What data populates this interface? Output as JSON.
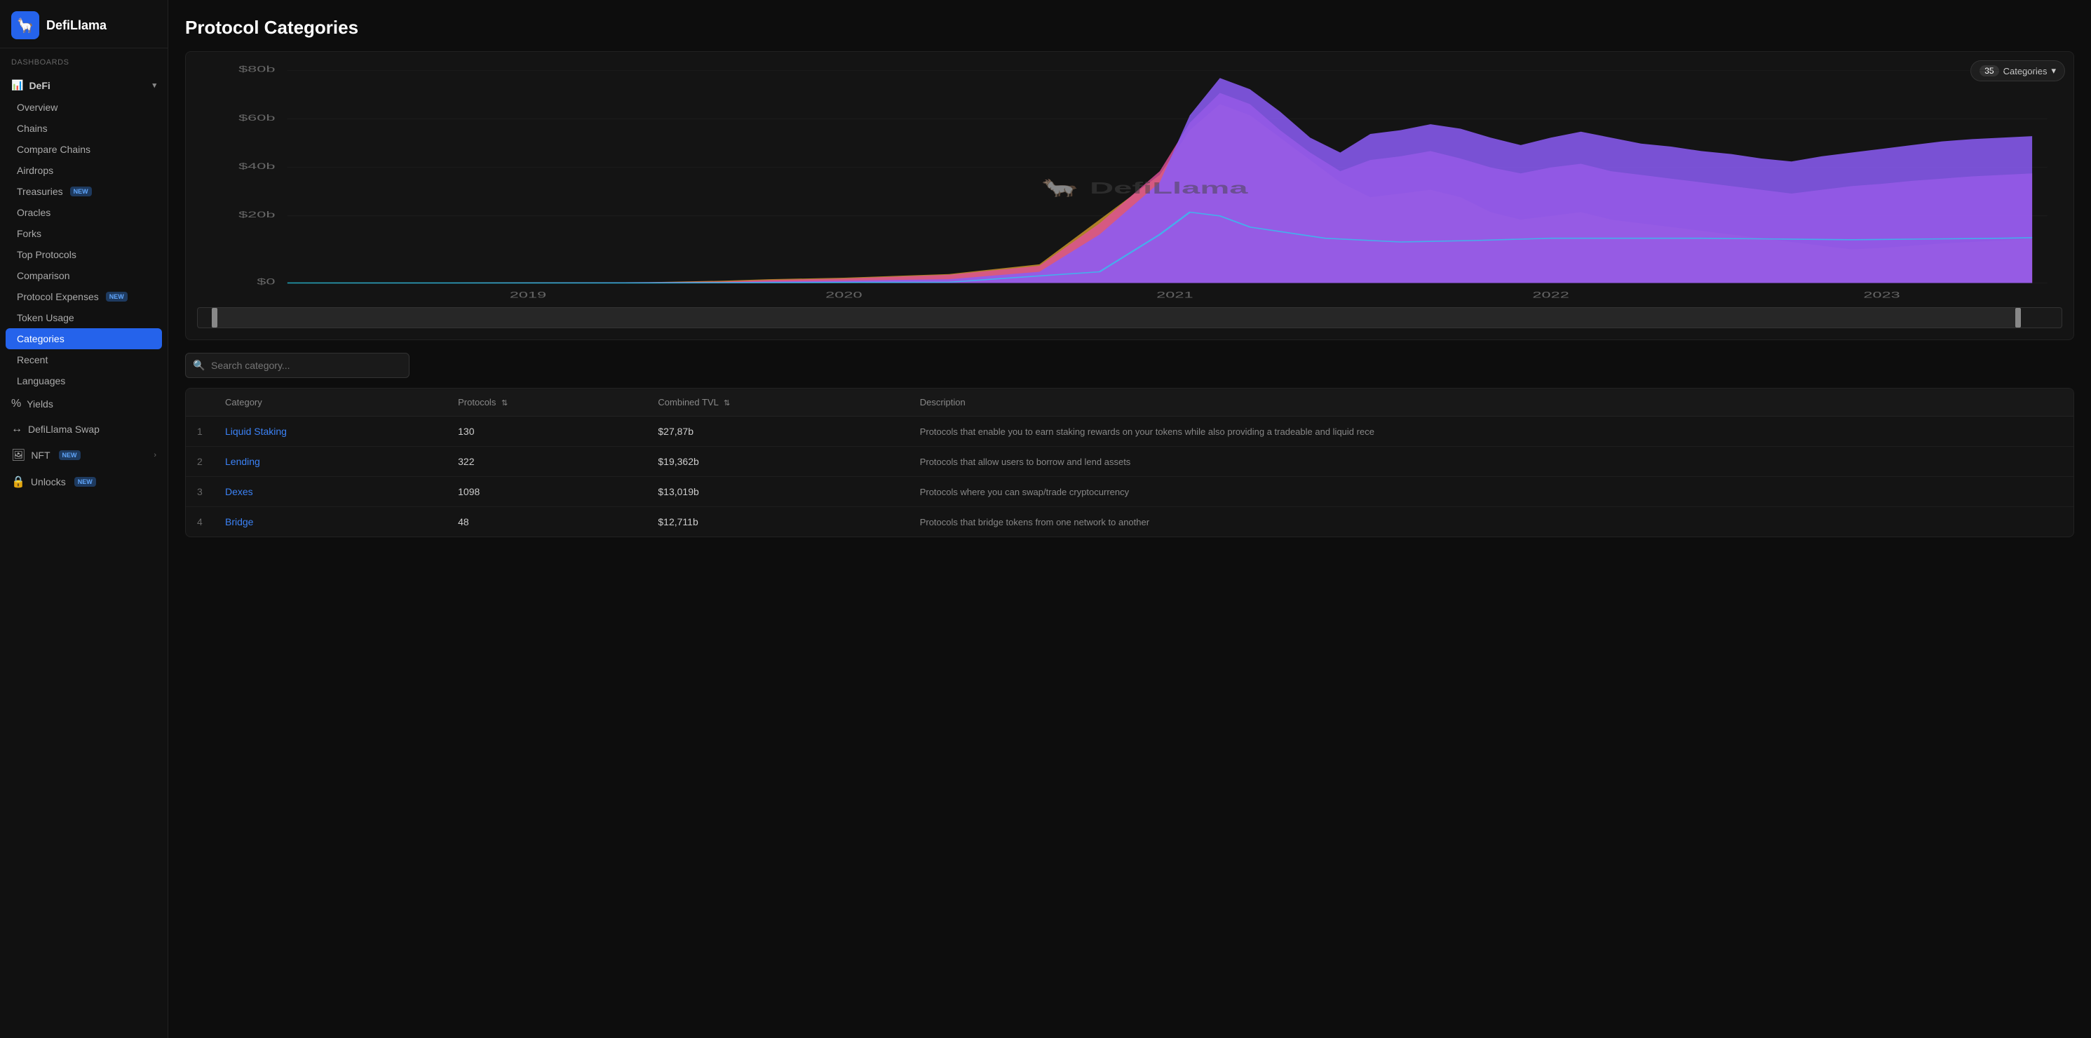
{
  "app": {
    "logo_emoji": "🦙",
    "logo_name": "DefiLlama"
  },
  "sidebar": {
    "dashboards_label": "Dashboards",
    "defi_label": "DeFi",
    "defi_items": [
      {
        "id": "overview",
        "label": "Overview",
        "badge": null
      },
      {
        "id": "chains",
        "label": "Chains",
        "badge": null
      },
      {
        "id": "compare-chains",
        "label": "Compare Chains",
        "badge": null
      },
      {
        "id": "airdrops",
        "label": "Airdrops",
        "badge": null
      },
      {
        "id": "treasuries",
        "label": "Treasuries",
        "badge": "NEW"
      },
      {
        "id": "oracles",
        "label": "Oracles",
        "badge": null
      },
      {
        "id": "forks",
        "label": "Forks",
        "badge": null
      },
      {
        "id": "top-protocols",
        "label": "Top Protocols",
        "badge": null
      },
      {
        "id": "comparison",
        "label": "Comparison",
        "badge": null
      },
      {
        "id": "protocol-expenses",
        "label": "Protocol Expenses",
        "badge": "NEW"
      },
      {
        "id": "token-usage",
        "label": "Token Usage",
        "badge": null
      },
      {
        "id": "categories",
        "label": "Categories",
        "badge": null,
        "active": true
      },
      {
        "id": "recent",
        "label": "Recent",
        "badge": null
      },
      {
        "id": "languages",
        "label": "Languages",
        "badge": null
      }
    ],
    "yields_label": "Yields",
    "swap_label": "DefiLlama Swap",
    "nft_label": "NFT",
    "nft_badge": "NEW",
    "unlocks_label": "Unlocks",
    "unlocks_badge": "NEW"
  },
  "page": {
    "title": "Protocol Categories"
  },
  "chart": {
    "categories_count": "35",
    "categories_btn_label": "Categories",
    "y_labels": [
      "$80b",
      "$60b",
      "$40b",
      "$20b",
      "$0"
    ],
    "x_labels": [
      "2019",
      "2020",
      "2021",
      "2022",
      "2023"
    ],
    "watermark": "DefiLlama"
  },
  "search": {
    "placeholder": "Search category..."
  },
  "table": {
    "columns": [
      {
        "id": "num",
        "label": ""
      },
      {
        "id": "category",
        "label": "Category"
      },
      {
        "id": "protocols",
        "label": "Protocols",
        "sortable": true
      },
      {
        "id": "tvl",
        "label": "Combined TVL",
        "sortable": true
      },
      {
        "id": "description",
        "label": "Description"
      }
    ],
    "rows": [
      {
        "num": "1",
        "category": "Liquid Staking",
        "protocols": "130",
        "tvl": "$27,87b",
        "description": "Protocols that enable you to earn staking rewards on your tokens while also providing a tradeable and liquid rece"
      },
      {
        "num": "2",
        "category": "Lending",
        "protocols": "322",
        "tvl": "$19,362b",
        "description": "Protocols that allow users to borrow and lend assets"
      },
      {
        "num": "3",
        "category": "Dexes",
        "protocols": "1098",
        "tvl": "$13,019b",
        "description": "Protocols where you can swap/trade cryptocurrency"
      },
      {
        "num": "4",
        "category": "Bridge",
        "protocols": "48",
        "tvl": "$12,711b",
        "description": "Protocols that bridge tokens from one network to another"
      }
    ]
  }
}
